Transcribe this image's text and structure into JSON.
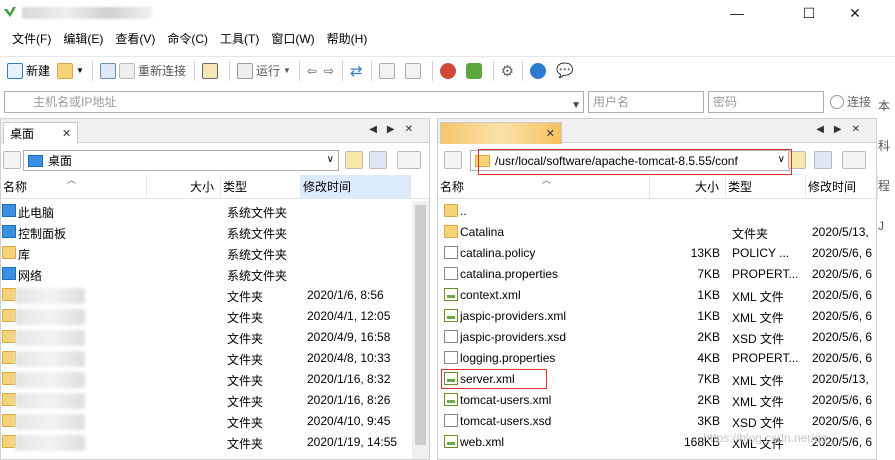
{
  "window": {
    "controls": {
      "minimize": "—",
      "maximize": "☐",
      "close": "✕"
    }
  },
  "menu": [
    "文件(F)",
    "编辑(E)",
    "查看(V)",
    "命令(C)",
    "工具(T)",
    "窗口(W)",
    "帮助(H)"
  ],
  "toolbar": {
    "new_label": "新建",
    "reconnect_label": "重新连接",
    "run_label": "运行"
  },
  "quick_connect": {
    "host_placeholder": "主机名或IP地址",
    "user_placeholder": "用户名",
    "password_placeholder": "密码",
    "connect_label": "连接"
  },
  "side_text": [
    "本科",
    "程J"
  ],
  "left": {
    "tab_label": "桌面",
    "path": "桌面",
    "columns": {
      "name": "名称",
      "size": "大小",
      "type": "类型",
      "mtime": "修改时间"
    },
    "rows": [
      {
        "name": "此电脑",
        "size": "",
        "type": "系统文件夹",
        "mtime": "",
        "icon": "computer"
      },
      {
        "name": "控制面板",
        "size": "",
        "type": "系统文件夹",
        "mtime": "",
        "icon": "control-panel"
      },
      {
        "name": "库",
        "size": "",
        "type": "系统文件夹",
        "mtime": "",
        "icon": "library"
      },
      {
        "name": "网络",
        "size": "",
        "type": "系统文件夹",
        "mtime": "",
        "icon": "network"
      },
      {
        "name": "ec……ldsj",
        "size": "",
        "type": "文件夹",
        "mtime": "2020/1/6, 8:56",
        "icon": "folder"
      },
      {
        "name": "h……d",
        "size": "",
        "type": "文件夹",
        "mtime": "2020/4/1, 12:05",
        "icon": "folder"
      },
      {
        "name": "h……in",
        "size": "",
        "type": "文件夹",
        "mtime": "2020/4/9, 16:58",
        "icon": "folder"
      },
      {
        "name": "h……tend",
        "size": "",
        "type": "文件夹",
        "mtime": "2020/4/8, 10:33",
        "icon": "folder"
      },
      {
        "name": "……de",
        "size": "",
        "type": "文件夹",
        "mtime": "2020/1/16, 8:32",
        "icon": "folder"
      },
      {
        "name": "……TT.js",
        "size": "",
        "type": "文件夹",
        "mtime": "2020/1/16, 8:26",
        "icon": "folder"
      },
      {
        "name": "……proje",
        "size": "",
        "type": "文件夹",
        "mtime": "2020/4/10, 9:45",
        "icon": "folder"
      },
      {
        "name": "n……nflux",
        "size": "",
        "type": "文件夹",
        "mtime": "2020/1/19, 14:55",
        "icon": "folder"
      }
    ]
  },
  "right": {
    "tab_label": "",
    "path": "/usr/local/software/apache-tomcat-8.5.55/conf",
    "columns": {
      "name": "名称",
      "size": "大小",
      "type": "类型",
      "mtime": "修改时间"
    },
    "rows": [
      {
        "name": "..",
        "size": "",
        "type": "",
        "mtime": "",
        "icon": "folder"
      },
      {
        "name": "Catalina",
        "size": "",
        "type": "文件夹",
        "mtime": "2020/5/13,",
        "icon": "folder"
      },
      {
        "name": "catalina.policy",
        "size": "13KB",
        "type": "POLICY ...",
        "mtime": "2020/5/6, 6",
        "icon": "doc"
      },
      {
        "name": "catalina.properties",
        "size": "7KB",
        "type": "PROPERT...",
        "mtime": "2020/5/6, 6",
        "icon": "doc"
      },
      {
        "name": "context.xml",
        "size": "1KB",
        "type": "XML 文件",
        "mtime": "2020/5/6, 6",
        "icon": "xml"
      },
      {
        "name": "jaspic-providers.xml",
        "size": "1KB",
        "type": "XML 文件",
        "mtime": "2020/5/6, 6",
        "icon": "xml"
      },
      {
        "name": "jaspic-providers.xsd",
        "size": "2KB",
        "type": "XSD 文件",
        "mtime": "2020/5/6, 6",
        "icon": "doc"
      },
      {
        "name": "logging.properties",
        "size": "4KB",
        "type": "PROPERT...",
        "mtime": "2020/5/6, 6",
        "icon": "doc"
      },
      {
        "name": "server.xml",
        "size": "7KB",
        "type": "XML 文件",
        "mtime": "2020/5/13,",
        "icon": "xml"
      },
      {
        "name": "tomcat-users.xml",
        "size": "2KB",
        "type": "XML 文件",
        "mtime": "2020/5/6, 6",
        "icon": "xml"
      },
      {
        "name": "tomcat-users.xsd",
        "size": "3KB",
        "type": "XSD 文件",
        "mtime": "2020/5/6, 6",
        "icon": "doc"
      },
      {
        "name": "web.xml",
        "size": "168KB",
        "type": "XML 文件",
        "mtime": "2020/5/6, 6",
        "icon": "xml"
      }
    ]
  },
  "watermark": "https://blog.csdn.net/qq_…",
  "colors": {
    "highlight_red": "#d9342b",
    "folder": "#f6d37a",
    "sorted_col": "#dcebfc"
  }
}
